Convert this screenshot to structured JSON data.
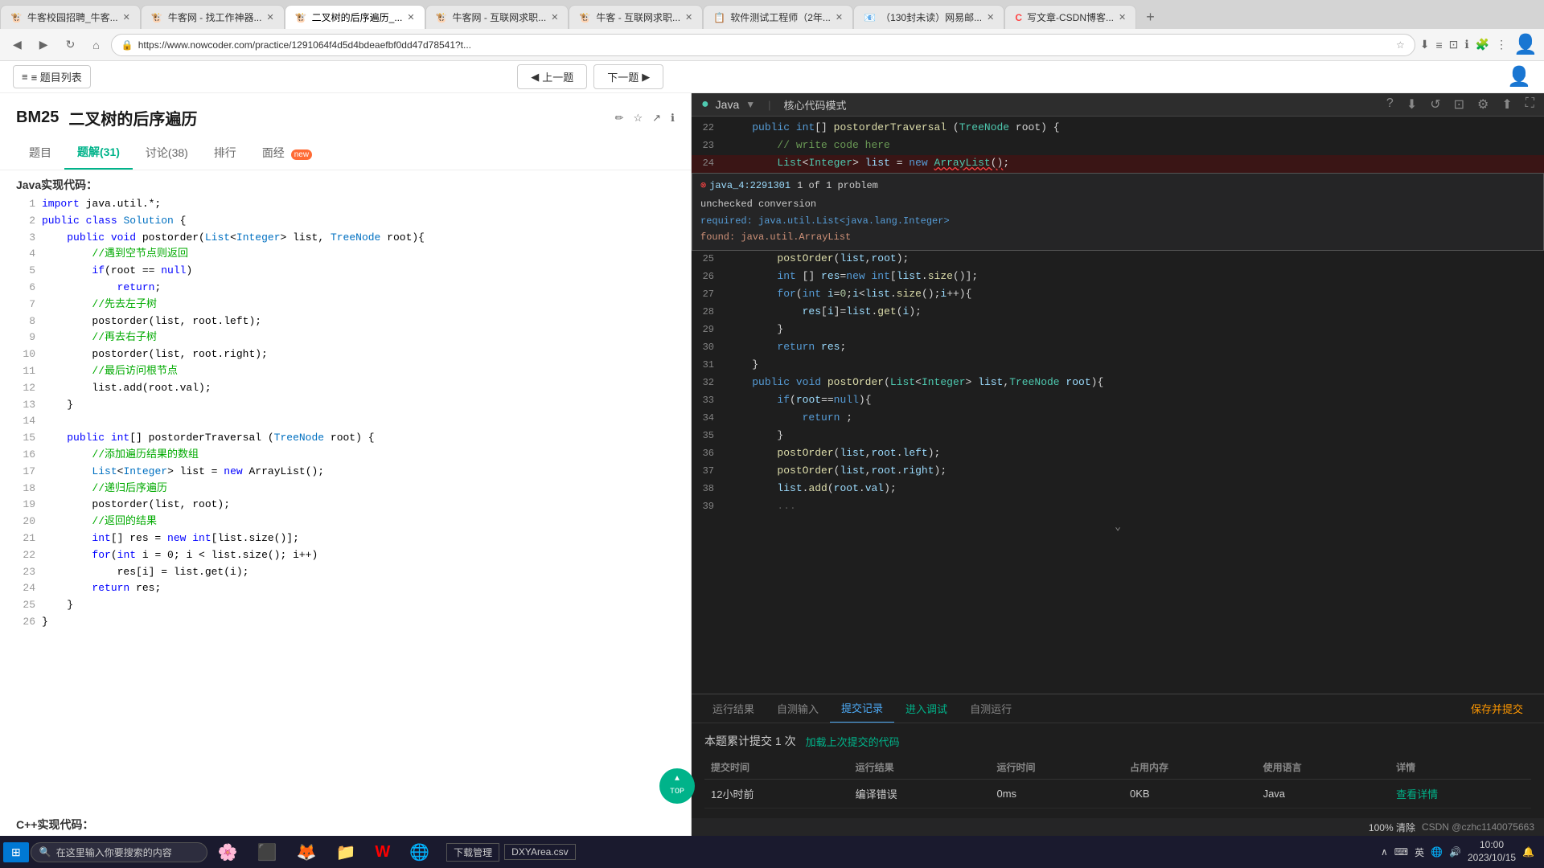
{
  "tabs": [
    {
      "label": "牛客校园招聘_牛客...",
      "icon": "🐮",
      "active": false,
      "color": "#f0a020"
    },
    {
      "label": "牛客网 - 找工作神器...",
      "icon": "🐮",
      "active": false,
      "color": "#f0a020"
    },
    {
      "label": "二叉树的后序遍历_...",
      "icon": "🐮",
      "active": true,
      "color": "#f0a020"
    },
    {
      "label": "牛客网 - 互联网求职...",
      "icon": "🐮",
      "active": false,
      "color": "#f0a020"
    },
    {
      "label": "牛客 - 互联网求职...",
      "icon": "🐮",
      "active": false,
      "color": "#f0a020"
    },
    {
      "label": "软件测试工程师（2年...",
      "icon": "📋",
      "active": false,
      "color": "#888"
    },
    {
      "label": "（130封未读）网易邮...",
      "icon": "📧",
      "active": false,
      "color": "#f44"
    },
    {
      "label": "写文章-CSDN博客...",
      "icon": "C",
      "active": false,
      "color": "#f44"
    }
  ],
  "address_url": "https://www.nowcoder.com/practice/1291064f4d5d4bdeaefbf0dd47d78541?t...",
  "toolbar": {
    "menu_label": "≡ 题目列表",
    "prev_label": "◀ 上一题",
    "next_label": "下一题 ▶"
  },
  "problem": {
    "id": "BM25",
    "title": "二叉树的后序遍历",
    "tabs": [
      {
        "label": "题目",
        "active": false
      },
      {
        "label": "题解(31)",
        "active": true
      },
      {
        "label": "讨论(38)",
        "active": false
      },
      {
        "label": "排行",
        "active": false
      },
      {
        "label": "面经",
        "active": false,
        "badge": "new"
      }
    ],
    "section_label": "Java实现代码："
  },
  "code_lines": [
    {
      "num": 1,
      "text": "import java.util.*;"
    },
    {
      "num": 2,
      "text": "public class Solution {"
    },
    {
      "num": 3,
      "text": "    public void postorder(List<Integer> list, TreeNode root){"
    },
    {
      "num": 4,
      "text": "        //遇到空节点则返回"
    },
    {
      "num": 5,
      "text": "        if(root == null)"
    },
    {
      "num": 6,
      "text": "            return;"
    },
    {
      "num": 7,
      "text": "        //先去左子树"
    },
    {
      "num": 8,
      "text": "        postorder(list, root.left);"
    },
    {
      "num": 9,
      "text": "        //再去右子树"
    },
    {
      "num": 10,
      "text": "        postorder(list, root.right);"
    },
    {
      "num": 11,
      "text": "        //最后访问根节点"
    },
    {
      "num": 12,
      "text": "        list.add(root.val);"
    },
    {
      "num": 13,
      "text": "    }"
    },
    {
      "num": 14,
      "text": ""
    },
    {
      "num": 15,
      "text": "    public int[] postorderTraversal (TreeNode root) {"
    },
    {
      "num": 16,
      "text": "        //添加遍历结果的数组"
    },
    {
      "num": 17,
      "text": "        List<Integer> list = new ArrayList();"
    },
    {
      "num": 18,
      "text": "        //递归后序遍历"
    },
    {
      "num": 19,
      "text": "        postorder(list, root);"
    },
    {
      "num": 20,
      "text": "        //返回的结果"
    },
    {
      "num": 21,
      "text": "        int[] res = new int[list.size()];"
    },
    {
      "num": 22,
      "text": "        for(int i = 0; i < list.size(); i++)"
    },
    {
      "num": 23,
      "text": "            res[i] = list.get(i);"
    },
    {
      "num": 24,
      "text": "        return res;"
    },
    {
      "num": 25,
      "text": "    }"
    },
    {
      "num": 26,
      "text": "}"
    }
  ],
  "cpp_label": "C++实现代码：",
  "editor": {
    "language": "Java",
    "mode": "核心代码模式",
    "lines": [
      {
        "num": 22,
        "content": "    public int[] postorderTraversal (TreeNode root) {",
        "error": false
      },
      {
        "num": 23,
        "content": "        // write code here",
        "error": false,
        "comment": true
      },
      {
        "num": 24,
        "content": "        List<Integer> list = new ArrayList();",
        "error": true
      },
      {
        "num": 25,
        "content": "        postOrder(list,root);",
        "error": false
      },
      {
        "num": 26,
        "content": "        int [] res=new int[list.size()];",
        "error": false
      },
      {
        "num": 27,
        "content": "        for(int i=0;i<list.size();i++){",
        "error": false
      },
      {
        "num": 28,
        "content": "            res[i]=list.get(i);",
        "error": false
      },
      {
        "num": 29,
        "content": "        }",
        "error": false
      },
      {
        "num": 30,
        "content": "        return res;",
        "error": false
      },
      {
        "num": 31,
        "content": "    }",
        "error": false
      },
      {
        "num": 32,
        "content": "    public void postOrder(List<Integer> list,TreeNode root){",
        "error": false
      },
      {
        "num": 33,
        "content": "        if(root==null){",
        "error": false
      },
      {
        "num": 34,
        "content": "            return ;",
        "error": false
      },
      {
        "num": 35,
        "content": "        }",
        "error": false
      },
      {
        "num": 36,
        "content": "        postOrder(list,root.left);",
        "error": false
      },
      {
        "num": 37,
        "content": "        postOrder(list,root.right);",
        "error": false
      },
      {
        "num": 38,
        "content": "        list.add(root.val);",
        "error": false
      },
      {
        "num": 39,
        "content": "        ...",
        "error": false
      }
    ],
    "error_tooltip": {
      "source": "java_4:2291301",
      "count": "1 of 1 problem",
      "title": "unchecked conversion",
      "required": "required: java.util.List<java.lang.Integer>",
      "found": "found:    java.util.ArrayList"
    }
  },
  "bottom_tabs": [
    {
      "label": "运行结果",
      "active": false
    },
    {
      "label": "自测输入",
      "active": false
    },
    {
      "label": "提交记录",
      "active": true,
      "color": "blue"
    },
    {
      "label": "进入调试",
      "active": false,
      "color": "green"
    },
    {
      "label": "自测运行",
      "active": false
    },
    {
      "label": "保存并提交",
      "active": false,
      "color": "orange"
    }
  ],
  "submission": {
    "title": "本题累计提交 1 次",
    "load_link": "加载上次提交的代码",
    "headers": [
      "提交时间",
      "运行结果",
      "运行时间",
      "占用内存",
      "使用语言",
      "详情"
    ],
    "rows": [
      {
        "time": "12小时前",
        "result": "编译错误",
        "runtime": "0ms",
        "memory": "0KB",
        "language": "Java",
        "detail": "查看详情"
      }
    ]
  },
  "taskbar": {
    "start": "⊞",
    "search_placeholder": "在这里输入你要搜索的内容",
    "items": [
      "📁",
      "🌐",
      "W",
      "🔧"
    ],
    "time": "10:00",
    "date": "2023",
    "status_text": "100% 清除",
    "username": "CSDN @czhc1140075663"
  },
  "scroll_top": "TOP"
}
